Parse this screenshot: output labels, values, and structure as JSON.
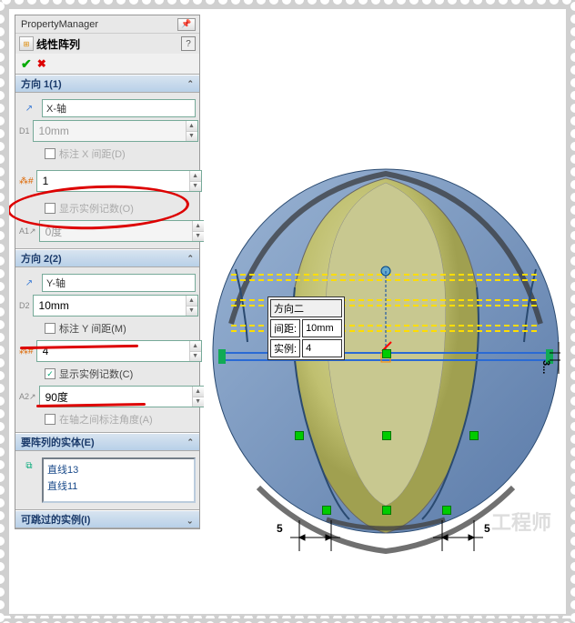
{
  "pm_title": "PropertyManager",
  "feature_name": "线性阵列",
  "sections": {
    "dir1": {
      "title": "方向 1(1)",
      "axis": "X-轴",
      "spacing": "10mm",
      "dim_label": "标注 X 间距(D)",
      "count": "1",
      "show_instances": "显示实例记数(O)",
      "angle": "0度"
    },
    "dir2": {
      "title": "方向 2(2)",
      "axis": "Y-轴",
      "spacing": "10mm",
      "dim_label": "标注 Y 间距(M)",
      "count": "4",
      "show_instances": "显示实例记数(C)",
      "angle": "90度",
      "angle_label": "在轴之间标注角度(A)"
    },
    "entities": {
      "title": "要阵列的实体(E)",
      "items": [
        "直线13",
        "直线11"
      ]
    },
    "skip": {
      "title": "可跳过的实例(I)"
    }
  },
  "callout": {
    "title": "方向二",
    "spacing_label": "间距:",
    "spacing_value": "10mm",
    "count_label": "实例:",
    "count_value": "4"
  },
  "dims": {
    "left": "5",
    "right": "5",
    "side": "3..."
  }
}
